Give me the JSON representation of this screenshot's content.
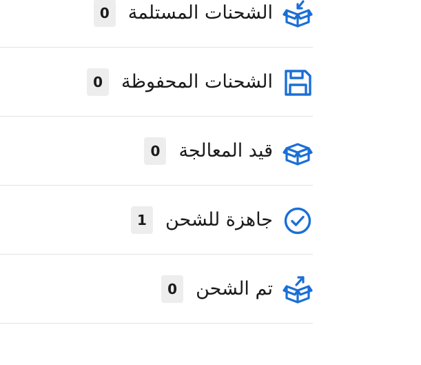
{
  "colors": {
    "accent": "#1a6fd6",
    "divider": "#e2e2e2",
    "badge_bg": "#ededed",
    "text": "#1a1a1a"
  },
  "status_list": [
    {
      "label": "الشحنات المستلمة",
      "count": "0",
      "icon": "box-arrow-in-icon"
    },
    {
      "label": "الشحنات المحفوظة",
      "count": "0",
      "icon": "save-icon"
    },
    {
      "label": "قيد المعالجة",
      "count": "0",
      "icon": "box-icon"
    },
    {
      "label": "جاهزة للشحن",
      "count": "1",
      "icon": "check-circle-icon"
    },
    {
      "label": "تم الشحن",
      "count": "0",
      "icon": "box-arrow-out-icon"
    }
  ]
}
